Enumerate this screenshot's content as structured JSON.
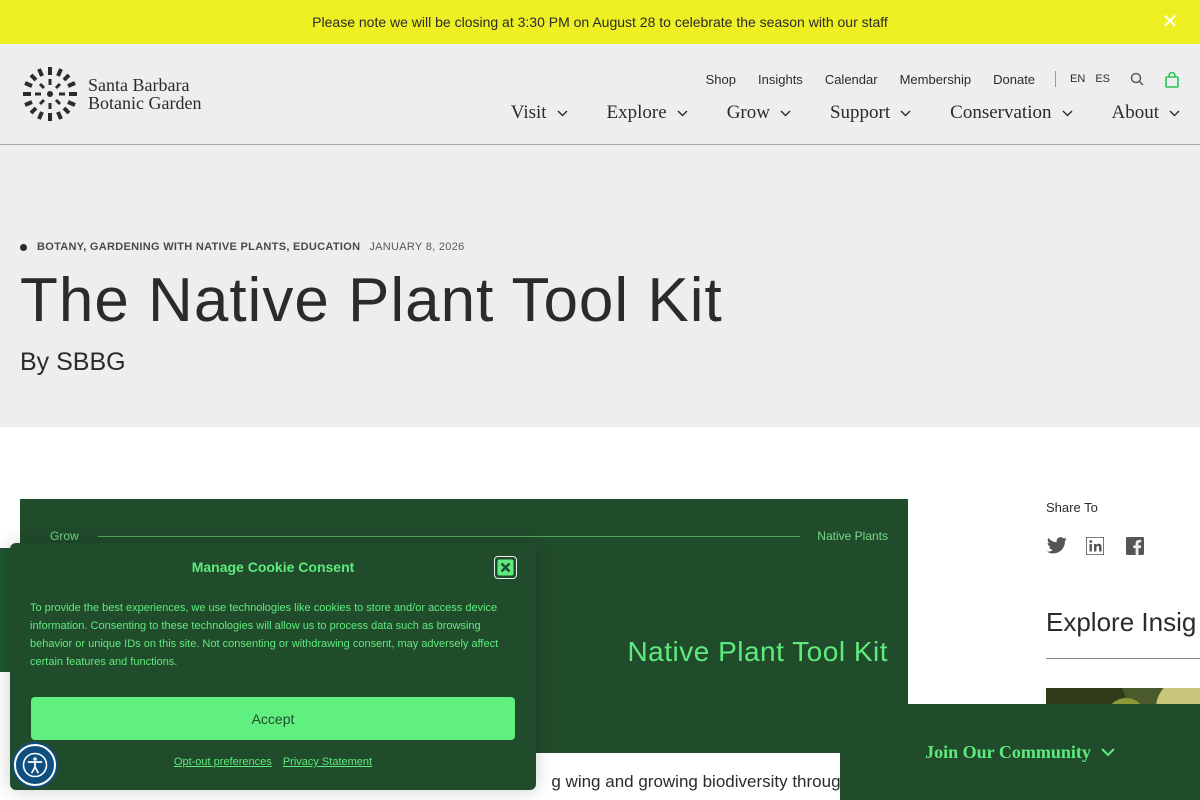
{
  "announcement": {
    "text": "Please note we will be closing at 3:30 PM on August 28 to celebrate the season with our staff"
  },
  "logo": {
    "line1": "Santa Barbara",
    "line2": "Botanic Garden"
  },
  "utility_nav": {
    "items": [
      "Shop",
      "Insights",
      "Calendar",
      "Membership",
      "Donate"
    ],
    "languages": [
      "EN",
      "ES"
    ]
  },
  "main_nav": {
    "items": [
      "Visit",
      "Explore",
      "Grow",
      "Support",
      "Conservation",
      "About"
    ]
  },
  "article": {
    "categories": "BOTANY, GARDENING WITH NATIVE PLANTS, EDUCATION",
    "date": "JANUARY 8, 2026",
    "title": "The Native Plant Tool Kit",
    "byline": "By SBBG",
    "banner": {
      "tag_left": "Grow",
      "tag_right": "Native Plants",
      "title": "Native Plant Tool Kit"
    },
    "intro_fragment": "g                          wing and growing biodiversity through"
  },
  "sidebar": {
    "share_label": "Share To",
    "explore_title": "Explore Insig"
  },
  "cookie": {
    "title": "Manage Cookie Consent",
    "body": "To provide the best experiences, we use technologies like cookies to store and/or access device information. Consenting to these technologies will allow us to process data such as browsing behavior or unique IDs on this site. Not consenting or withdrawing consent, may adversely affect certain features and functions.",
    "accept_label": "Accept",
    "optout_label": "Opt-out preferences",
    "privacy_label": "Privacy Statement"
  },
  "join": {
    "label": "Join Our Community"
  },
  "colors": {
    "announcement_bg": "#eef024",
    "header_bg": "#eeeeee",
    "brand_green": "#214c2c",
    "accent_green": "#5eeb7d",
    "accessibility_blue": "#0e4f80"
  },
  "icons": [
    "close-icon",
    "search-icon",
    "cart-icon",
    "chevron-down-icon",
    "twitter-icon",
    "linkedin-icon",
    "facebook-icon",
    "accessibility-icon"
  ]
}
